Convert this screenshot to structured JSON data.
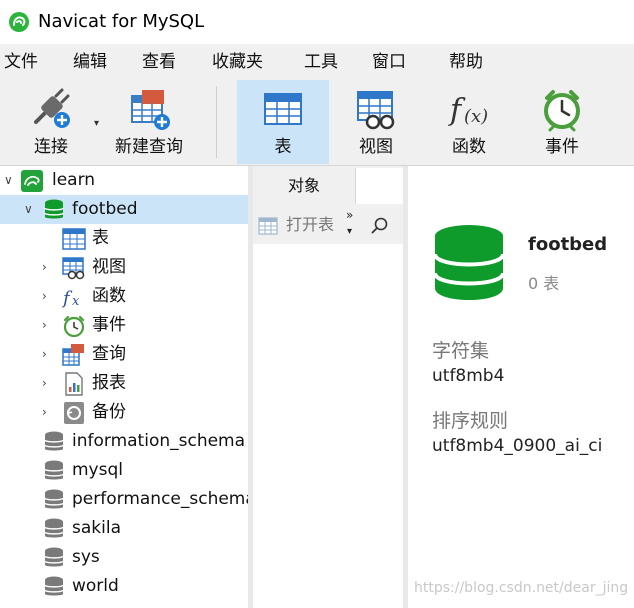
{
  "window": {
    "title": "Navicat for MySQL"
  },
  "menu": [
    "文件",
    "编辑",
    "查看",
    "收藏夹",
    "工具",
    "窗口",
    "帮助"
  ],
  "toolbar": {
    "connect": "连接",
    "new_query": "新建查询",
    "table": "表",
    "view": "视图",
    "function": "函数",
    "event": "事件"
  },
  "tree": {
    "connection": "learn",
    "database": "footbed",
    "children": [
      "表",
      "视图",
      "函数",
      "事件",
      "查询",
      "报表",
      "备份"
    ],
    "other_databases": [
      "information_schema",
      "mysql",
      "performance_schema",
      "sakila",
      "sys",
      "world"
    ]
  },
  "objects": {
    "tab": "对象",
    "open_table": "打开表"
  },
  "info": {
    "name": "footbed",
    "count": "0 表",
    "charset_label": "字符集",
    "charset_value": "utf8mb4",
    "collation_label": "排序规则",
    "collation_value": "utf8mb4_0900_ai_ci"
  },
  "watermark": "https://blog.csdn.net/dear_jing",
  "colors": {
    "accent": "#cce4f7",
    "db_green": "#0f9b2c",
    "toolbar_bg": "#f0f0f0"
  }
}
